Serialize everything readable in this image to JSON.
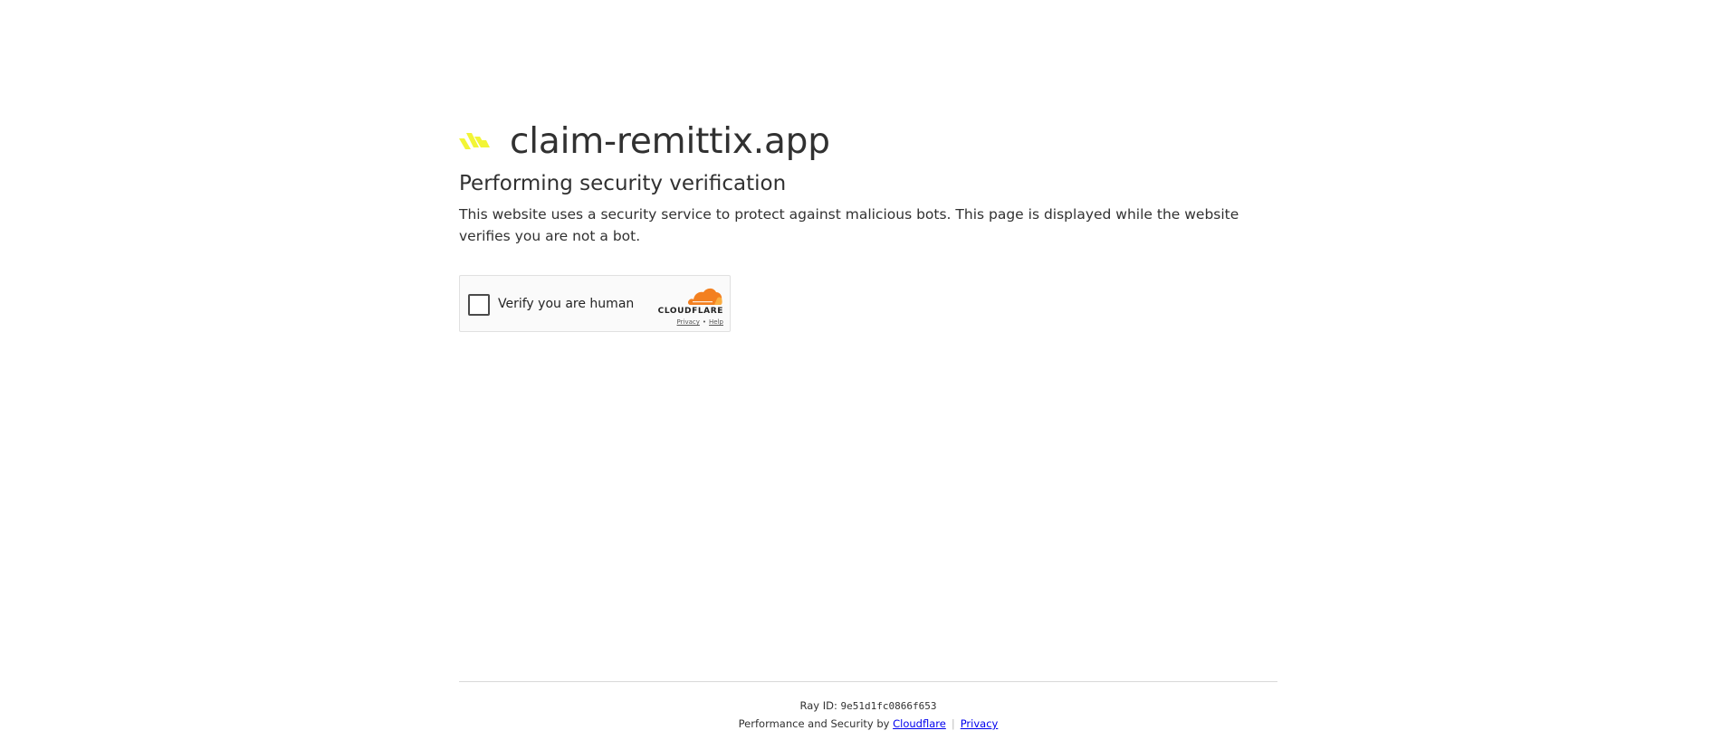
{
  "site": {
    "name": "claim-remittix.app",
    "logo_icon": "remittix-logo-icon",
    "logo_color": "#f2f536"
  },
  "main": {
    "heading": "Performing security verification",
    "description": "This website uses a security service to protect against malicious bots. This page is displayed while the website verifies you are not a bot."
  },
  "widget": {
    "checkbox_label": "Verify you are human",
    "brand_wordmark": "CLOUDFLARE",
    "brand_icon": "cloudflare-cloud-icon",
    "brand_color": "#f38020",
    "privacy_link": "Privacy",
    "separator": "•",
    "help_link": "Help"
  },
  "footer": {
    "ray_label": "Ray ID:",
    "ray_id": "9e51d1fc0866f653",
    "perf_prefix": "Performance and Security by",
    "cloudflare_link": "Cloudflare",
    "separator": "|",
    "privacy_link": "Privacy",
    "link_color": "#0000ee"
  }
}
